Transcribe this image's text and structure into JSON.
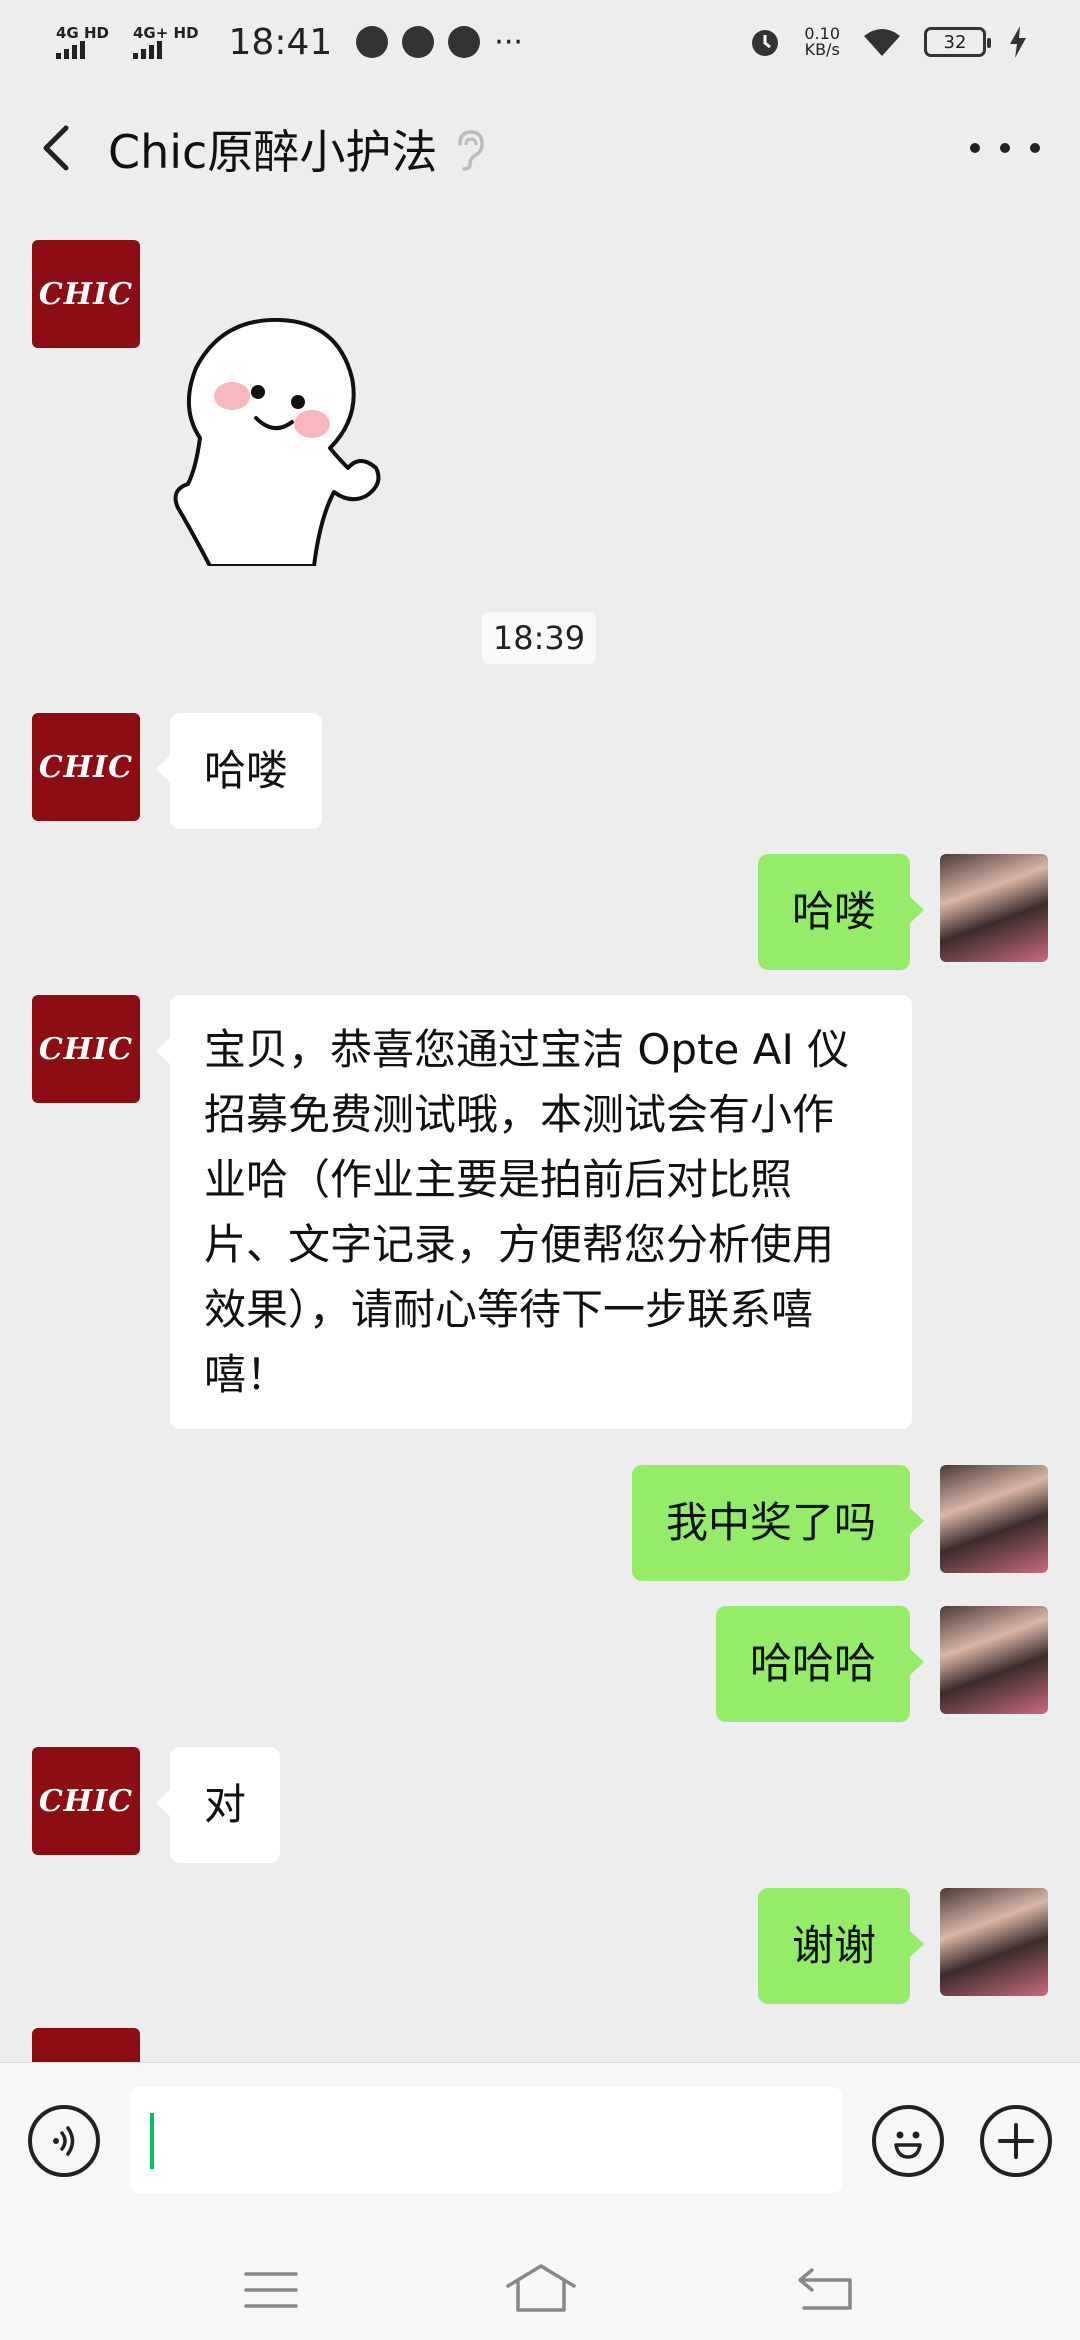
{
  "status_bar": {
    "time": "18:41",
    "sim1": "4G HD",
    "sim2": "4G+ HD",
    "net_speed_value": "0.10",
    "net_speed_unit": "KB/s",
    "battery": "32",
    "overflow": "···"
  },
  "header": {
    "title": "Chic原醉小护法",
    "back_icon": "chevron-left-icon",
    "ear_icon": "ear-icon",
    "more_icon": "more-dots-icon"
  },
  "contact_avatar_text": "CHIC",
  "messages": [
    {
      "side": "left",
      "type": "sticker"
    },
    {
      "side": "system",
      "type": "time",
      "text": "18:39"
    },
    {
      "side": "left",
      "type": "text",
      "text": "哈喽"
    },
    {
      "side": "right",
      "type": "text",
      "text": "哈喽"
    },
    {
      "side": "left",
      "type": "text",
      "lines": [
        "宝贝，恭喜您通过宝洁 Opte AI 仪",
        "招募免费测试哦，本测试会有小作",
        "业哈（作业主要是拍前后对比照",
        "片、文字记录，方便帮您分析使用",
        "效果），请耐心等待下一步联系嘻",
        "嘻！"
      ]
    },
    {
      "side": "right",
      "type": "text",
      "text": "我中奖了吗"
    },
    {
      "side": "right",
      "type": "text",
      "text": "哈哈哈"
    },
    {
      "side": "left",
      "type": "text",
      "text": "对"
    },
    {
      "side": "right",
      "type": "text",
      "text": "谢谢"
    }
  ],
  "input_bar": {
    "voice_icon": "voice-icon",
    "emoji_icon": "emoji-icon",
    "plus_icon": "plus-icon",
    "value": ""
  },
  "nav_bar": {
    "menu_icon": "menu-icon",
    "home_icon": "home-icon",
    "back_icon": "return-icon"
  },
  "colors": {
    "background": "#ededed",
    "bubble_self": "#95ec69",
    "bubble_other": "#ffffff",
    "brand_avatar": "#8c0d14",
    "caret": "#07c160"
  }
}
